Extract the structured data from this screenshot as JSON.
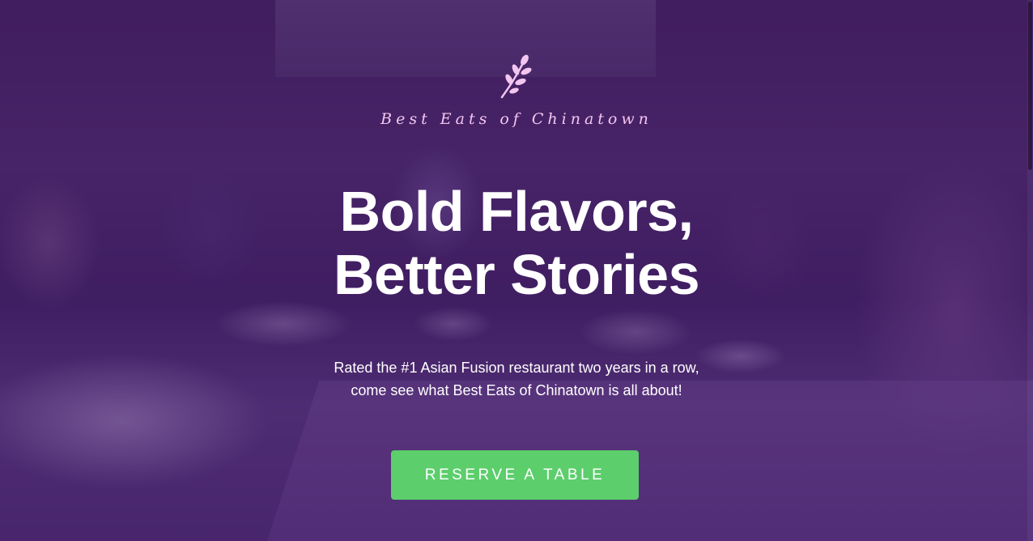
{
  "brand": {
    "name": "Best Eats of Chinatown",
    "logo_icon": "leaf-sprig-icon",
    "accent_color": "#f3c6ef"
  },
  "hero": {
    "headline_line1": "Bold Flavors,",
    "headline_line2": "Better Stories",
    "tagline_line1": "Rated the #1 Asian Fusion restaurant two years in a row,",
    "tagline_line2": "come see what Best Eats of Chinatown is all about!",
    "cta_label": "RESERVE A TABLE",
    "cta_color": "#5cce6c",
    "overlay_color": "#46146e"
  }
}
